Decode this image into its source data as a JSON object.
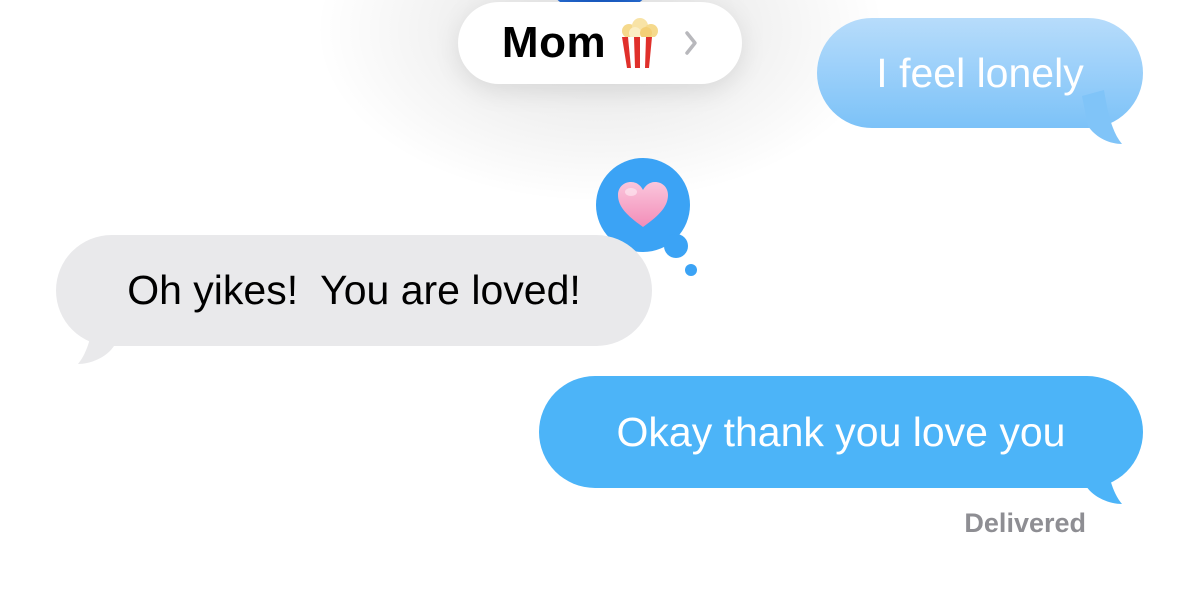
{
  "header": {
    "contact_name": "Mom",
    "contact_emoji_icon": "popcorn-icon",
    "chevron_icon": "chevron-right-icon"
  },
  "messages": [
    {
      "direction": "outgoing",
      "text": "I feel lonely",
      "color": "#8ccaf9"
    },
    {
      "direction": "incoming",
      "text": "Oh yikes!  You are loved!",
      "color": "#e9e9eb",
      "reaction_icon": "heart-icon"
    },
    {
      "direction": "outgoing",
      "text": "Okay thank you love you",
      "color": "#4cb4f8"
    }
  ],
  "status": {
    "label": "Delivered"
  },
  "colors": {
    "outgoing_bubble": "#4cb4f8",
    "incoming_bubble": "#e9e9eb",
    "tapback": "#3ba3f5",
    "heart": "#f7a6c9",
    "status_text": "#8e8e93"
  }
}
